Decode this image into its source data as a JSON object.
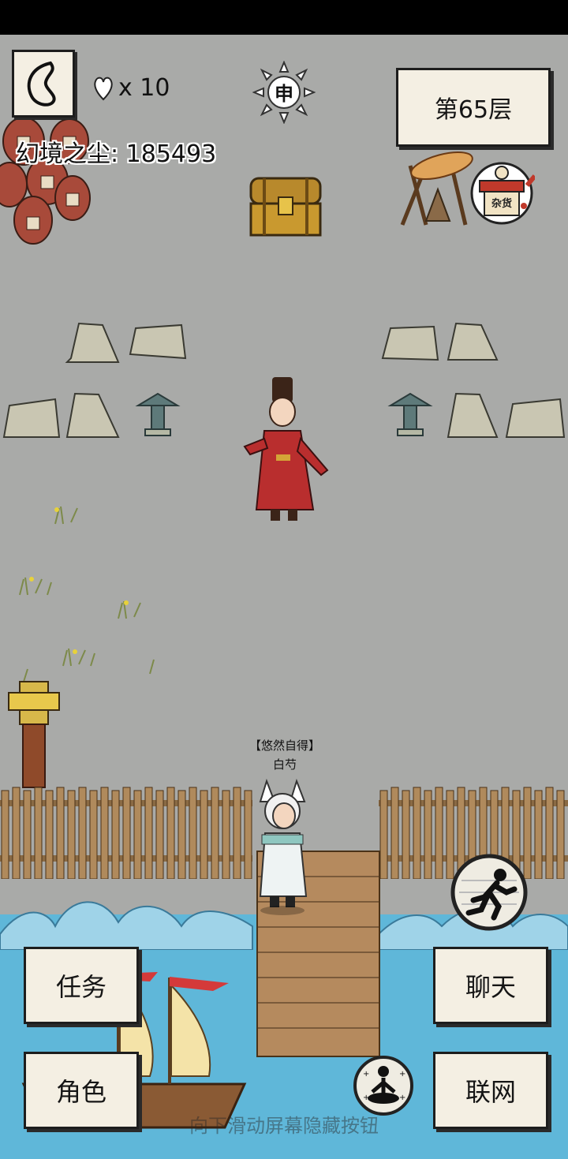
{
  "hud": {
    "lives_count": "x 10",
    "currency_label": "幻境之尘: 185493",
    "time_glyph": "申",
    "floor_label": "第65层",
    "shop_sign": "杂货"
  },
  "player": {
    "title": "【悠然自得】",
    "name": "白芍"
  },
  "buttons": {
    "task": "任务",
    "chat": "聊天",
    "role": "角色",
    "network": "联网"
  },
  "hint": "向下滑动屏幕隐藏按钮"
}
